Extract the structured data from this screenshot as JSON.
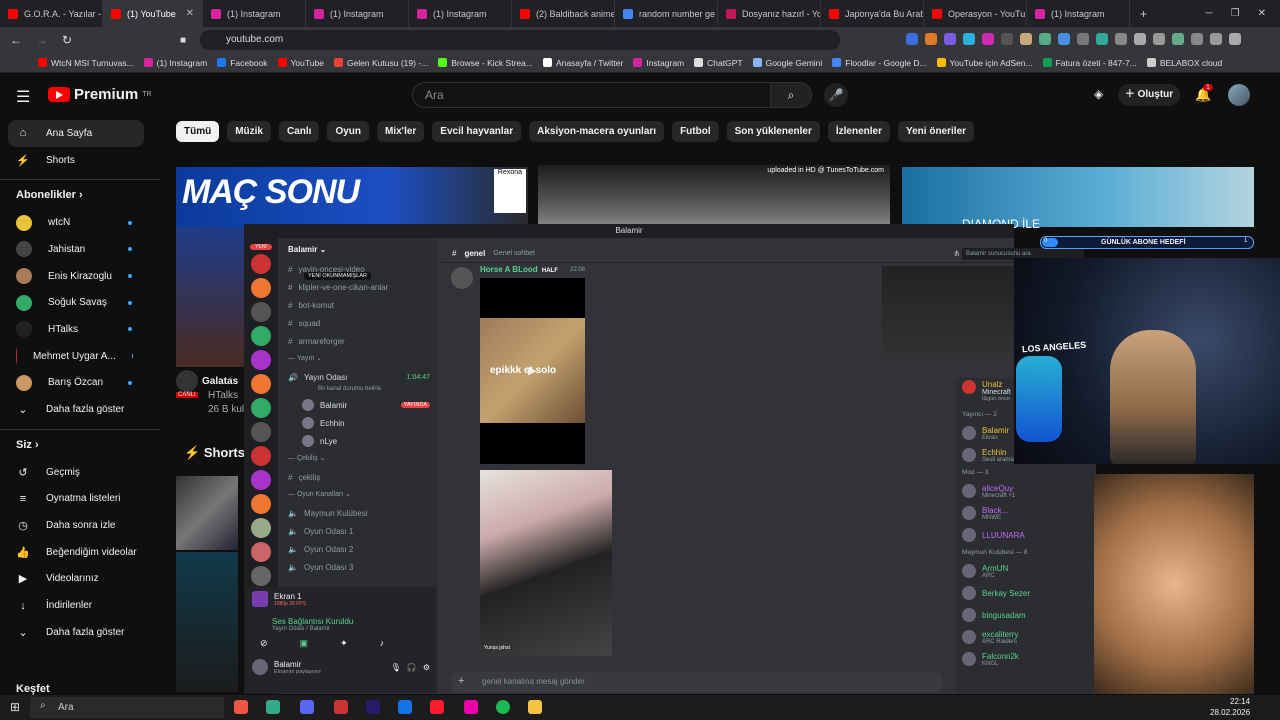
{
  "browser": {
    "tabs": [
      {
        "label": "G.O.R.A. - Yazılar - Y",
        "color": "#ff0000"
      },
      {
        "label": "(1) YouTube",
        "color": "#ff0000",
        "active": true
      },
      {
        "label": "(1) Instagram",
        "color": "#d6249f"
      },
      {
        "label": "(1) Instagram",
        "color": "#d6249f"
      },
      {
        "label": "(1) Instagram",
        "color": "#d6249f"
      },
      {
        "label": "(2) Baldiback anime",
        "color": "#ff0000"
      },
      {
        "label": "random number ge",
        "color": "#4285f4"
      },
      {
        "label": "Dosyanız hazırl - Yo",
        "color": "#c2185b"
      },
      {
        "label": "Japonya'da Bu Arab",
        "color": "#ff0000"
      },
      {
        "label": "Operasyon - YouTu",
        "color": "#ff0000"
      },
      {
        "label": "(1) Instagram",
        "color": "#d6249f"
      }
    ],
    "url": "youtube.com",
    "bookmarks": [
      {
        "label": "WtcN MSI Turnuvas...",
        "color": "#ff0000"
      },
      {
        "label": "(1) Instagram",
        "color": "#d6249f"
      },
      {
        "label": "Facebook",
        "color": "#1877f2"
      },
      {
        "label": "YouTube",
        "color": "#ff0000"
      },
      {
        "label": "Gelen Kutusu (19) -...",
        "color": "#ea4335"
      },
      {
        "label": "Browse - Kick Strea...",
        "color": "#53fc18"
      },
      {
        "label": "Anasayfa / Twitter",
        "color": "#ffffff"
      },
      {
        "label": "Instagram",
        "color": "#d6249f"
      },
      {
        "label": "ChatGPT",
        "color": "#dddddd"
      },
      {
        "label": "Google Gemini",
        "color": "#8ab4f8"
      },
      {
        "label": "Floodlar - Google D...",
        "color": "#4285f4"
      },
      {
        "label": "YouTube için AdSen...",
        "color": "#fbbc04"
      },
      {
        "label": "Fatura özeti - 847-7...",
        "color": "#0f9d58"
      },
      {
        "label": "BELABOX cloud",
        "color": "#cccccc"
      }
    ]
  },
  "youtube": {
    "logo": "Premium",
    "logo_sup": "TR",
    "search_placeholder": "Ara",
    "create_label": "Oluştur",
    "notif_count": "1",
    "chips": [
      "Tümü",
      "Müzik",
      "Canlı",
      "Oyun",
      "Mix'ler",
      "Evcil hayvanlar",
      "Aksiyon-macera oyunları",
      "Futbol",
      "Son yüklenenler",
      "İzlenenler",
      "Yeni öneriler"
    ],
    "nav": [
      {
        "label": "Ana Sayfa",
        "icon": "home-icon",
        "glyph": "⌂"
      },
      {
        "label": "Shorts",
        "icon": "shorts-icon",
        "glyph": "⚡"
      }
    ],
    "subs_title": "Abonelikler",
    "subs": [
      {
        "label": "wtcN",
        "color": "#e8c33a"
      },
      {
        "label": "Jahistan",
        "color": "#444"
      },
      {
        "label": "Enis Kirazoglu",
        "color": "#a67c5b"
      },
      {
        "label": "Soğuk Savaş",
        "color": "#3a6"
      },
      {
        "label": "HTalks",
        "color": "#222"
      },
      {
        "label": "Mehmet Uygar A...",
        "color": "#b33"
      },
      {
        "label": "Barış Özcan",
        "color": "#c96"
      }
    ],
    "more_label": "Daha fazla göster",
    "you_title": "Siz",
    "you_items": [
      {
        "label": "Geçmiş",
        "glyph": "↺"
      },
      {
        "label": "Oynatma listeleri",
        "glyph": "≡"
      },
      {
        "label": "Daha sonra izle",
        "glyph": "◷"
      },
      {
        "label": "Beğendiğim videolar",
        "glyph": "👍"
      },
      {
        "label": "Videolarınız",
        "glyph": "▶"
      },
      {
        "label": "İndirilenler",
        "glyph": "↓"
      },
      {
        "label": "Daha fazla göster",
        "glyph": "⌄"
      }
    ],
    "explore_title": "Keşfet",
    "thumb1_title": "MAÇ SONU",
    "thumb1_brand": "Rexona",
    "thumb2_overlay": "uploaded in HD @ TunesToTube.com",
    "thumb3_title": "DIAMOND İLE",
    "channel_snip": "Galatas",
    "channel_name": "HTalks",
    "channel_views": "26 B kul",
    "live_badge": "CANLI",
    "shorts_label": "Shorts"
  },
  "discord": {
    "window_title": "Balamir",
    "server_name": "Balamir",
    "new_badge": "YENİ",
    "unread_tooltip": "YENİ OKUNMAMIŞLAR",
    "channels_top": [
      {
        "label": "yayin-oncesi-video",
        "bright": false
      },
      {
        "label": "klipler-ve-one-cikan-anlar",
        "bright": false
      },
      {
        "label": "bot-komut",
        "bright": false
      },
      {
        "label": "squad",
        "bright": false
      },
      {
        "label": "armareforger",
        "bright": false
      }
    ],
    "cat_yayin": "Yayın",
    "voice_channel": "Yayın Odası",
    "voice_time": "1:04:47",
    "voice_status": "Bir kanal durumu belirle",
    "voice_users": [
      {
        "name": "Balamir",
        "badge": "YAYINDA"
      },
      {
        "name": "Echhin",
        "badge": ""
      },
      {
        "name": "nLye",
        "badge": ""
      }
    ],
    "cat_cekilis": "Çekiliş",
    "cekilis_channel": "çekiliş",
    "cat_oyun": "Oyun Kanalları",
    "game_channels": [
      "Maymun Kulübesi",
      "Oyun Odası 1",
      "Oyun Odası 2",
      "Oyun Odası 3"
    ],
    "stream_title": "Ekran 1",
    "stream_sub": "1080p 30 FPS",
    "voice_connected": "Ses Bağlantısı Kuruldu",
    "voice_connected_sub": "Yayın Odası / Balamir",
    "user_name": "Balamir",
    "user_status": "Ekranını paylaşıyor",
    "chat_channel": "genel",
    "chat_topic": "Genel sohbet",
    "search_placeholder": "Balamir sunucusunu ara",
    "message_author": "Horse A BLood",
    "message_tag": "HALF",
    "message_time": "22:08",
    "video_caption": "epikkk et solo",
    "video2_caption": "Yunus jahst",
    "input_placeholder": "genel kanalına mesaj gönder",
    "members": {
      "unalz": "Unalz",
      "unalz_game": "Minecraft",
      "unalz_sub": "İ&gün önce",
      "yayinci_section": "Yayıncı — 2",
      "yayincilar": [
        {
          "name": "Balamir",
          "sub": "Ekran",
          "color": "#e8c33a"
        },
        {
          "name": "Echhin",
          "sub": "Sesli aramada",
          "color": "#e8c33a"
        }
      ],
      "mod_section": "Mod — 3",
      "mods": [
        {
          "name": "aliceQuy",
          "sub": "Minecraft +1",
          "color": "#c06cff"
        },
        {
          "name": "Black...",
          "sub": "MNWE",
          "color": "#c06cff"
        },
        {
          "name": "LLUUNARA",
          "sub": "",
          "color": "#c06cff"
        }
      ],
      "maymun_section": "Maymun Kulübesi — 8",
      "others": [
        {
          "name": "ArmUN",
          "sub": "ARC",
          "color": "#57d28f"
        },
        {
          "name": "Berkay Sezer",
          "sub": "",
          "color": "#57d28f"
        },
        {
          "name": "bingusadam",
          "sub": "",
          "color": "#57d28f"
        },
        {
          "name": "excaliterry",
          "sub": "ARC Raiders",
          "color": "#57d28f"
        },
        {
          "name": "Falconn2k",
          "sub": "KNGL",
          "color": "#57d28f"
        }
      ]
    }
  },
  "overlay": {
    "goal_label": "GÜNLÜK ABONE HEDEFİ",
    "goal_current": "0",
    "goal_max": "1",
    "goal_progress": 0.0,
    "poster_text": "LOS ANGELES"
  },
  "taskbar": {
    "search": "Ara",
    "time": "22:14",
    "date": "28.02.2026"
  }
}
